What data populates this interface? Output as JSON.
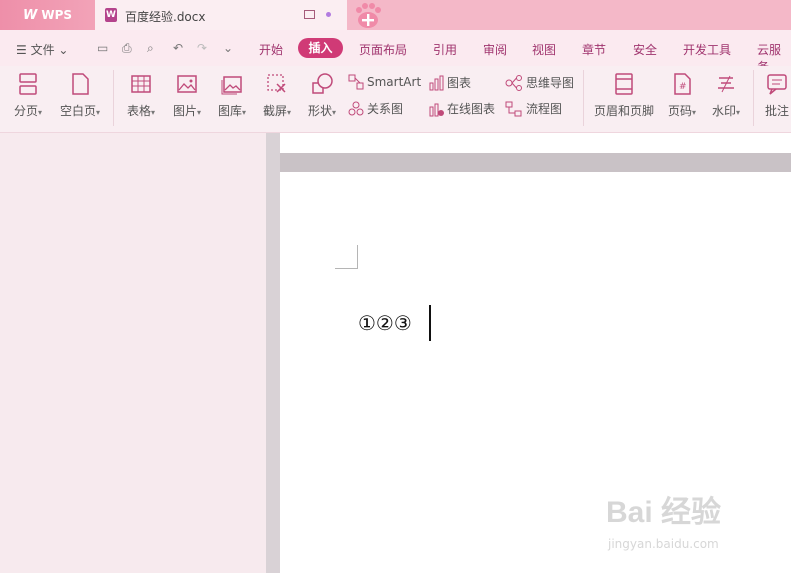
{
  "tabs": {
    "app_brand": "WPS",
    "document_title": "百度经验.docx"
  },
  "menu": {
    "file": "文件",
    "items": [
      "开始",
      "插入",
      "页面布局",
      "引用",
      "审阅",
      "视图",
      "章节",
      "安全",
      "开发工具",
      "云服务"
    ],
    "active": "插入"
  },
  "ribbon": {
    "page_break": "分页",
    "blank_page": "空白页",
    "table": "表格",
    "picture": "图片",
    "gallery": "图库",
    "screenshot": "截屏",
    "shape": "形状",
    "smartart": "SmartArt",
    "relation": "关系图",
    "chart": "图表",
    "online_chart": "在线图表",
    "mindmap": "思维导图",
    "flowchart": "流程图",
    "header_footer": "页眉和页脚",
    "page_number": "页码",
    "watermark": "水印",
    "comment": "批注"
  },
  "document": {
    "content": "①②③"
  },
  "watermark": {
    "brand": "Bai 经验",
    "url": "jingyan.baidu.com"
  },
  "colors": {
    "accent": "#d03a76",
    "tab_bar": "#f4b8c8",
    "menu_text": "#a0346e"
  }
}
